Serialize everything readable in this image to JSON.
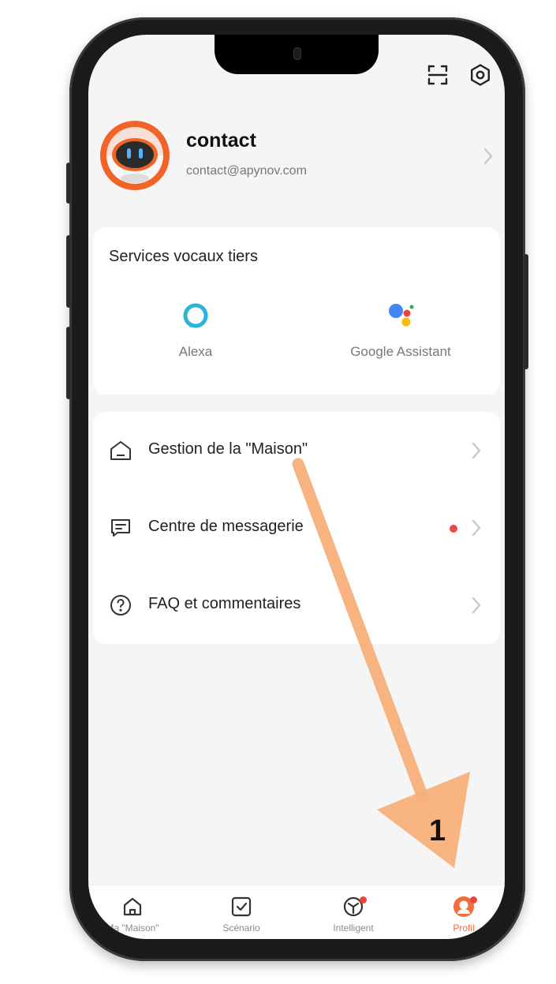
{
  "profile": {
    "name": "contact",
    "email": "contact@apynov.com"
  },
  "voice_services": {
    "title": "Services vocaux tiers",
    "items": [
      {
        "label": "Alexa",
        "icon": "alexa-icon"
      },
      {
        "label": "Google Assistant",
        "icon": "google-assistant-icon"
      }
    ]
  },
  "menu": {
    "items": [
      {
        "label": "Gestion de la \"Maison\"",
        "icon": "home-outline-icon",
        "has_dot": false
      },
      {
        "label": "Centre de messagerie",
        "icon": "message-icon",
        "has_dot": true
      },
      {
        "label": "FAQ et commentaires",
        "icon": "question-circle-icon",
        "has_dot": false
      }
    ]
  },
  "tabbar": {
    "items": [
      {
        "label": "Ma \"Maison\"",
        "icon": "home-icon",
        "active": false
      },
      {
        "label": "Scénario",
        "icon": "checkbox-icon",
        "active": false
      },
      {
        "label": "Intelligent",
        "icon": "cube-icon",
        "active": false,
        "badge": true
      },
      {
        "label": "Profil",
        "icon": "profile-icon",
        "active": true,
        "badge": true
      }
    ]
  },
  "annotation": {
    "step_number": "1"
  },
  "colors": {
    "accent": "#f26c3c",
    "badge_red": "#e8463c",
    "arrow": "#f8b07a",
    "screen_bg": "#f5f5f6"
  }
}
